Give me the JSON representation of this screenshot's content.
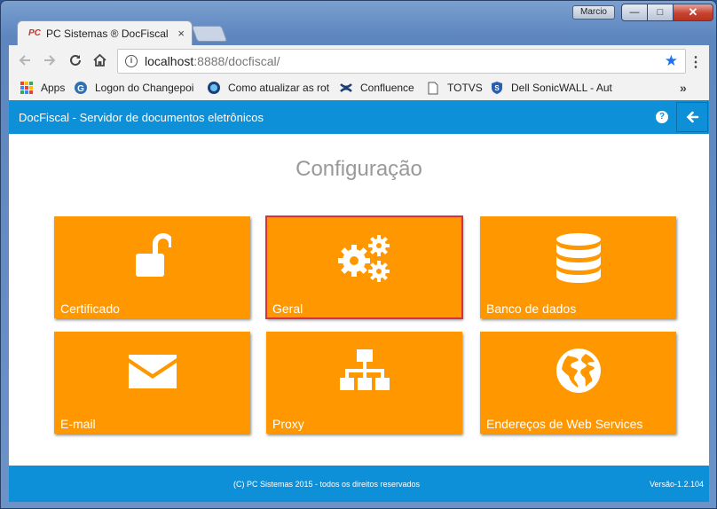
{
  "window": {
    "user_label": "Marcio",
    "minimize_glyph": "—",
    "maximize_glyph": "□",
    "close_glyph": "✕"
  },
  "tab": {
    "favicon_text": "PC",
    "title": "PC Sistemas ® DocFiscal",
    "close_glyph": "×"
  },
  "address_bar": {
    "host": "localhost",
    "rest": ":8888/docfiscal/"
  },
  "bookmarks": [
    {
      "label": "Apps",
      "icon": "apps-grid-icon"
    },
    {
      "label": "Logon do Changepoi",
      "icon": "changepoint-icon"
    },
    {
      "label": "Como atualizar as rot",
      "icon": "globe-icon"
    },
    {
      "label": "Confluence",
      "icon": "confluence-icon"
    },
    {
      "label": "TOTVS",
      "icon": "page-icon"
    },
    {
      "label": "Dell SonicWALL - Aut",
      "icon": "shield-icon"
    }
  ],
  "bookmarks_more": "»",
  "app": {
    "header_title": "DocFiscal - Servidor de documentos eletrônicos",
    "help_glyph": "?",
    "page_title": "Configuração",
    "tiles": [
      {
        "label": "Certificado",
        "icon": "unlock-icon",
        "selected": false
      },
      {
        "label": "Geral",
        "icon": "gears-icon",
        "selected": true
      },
      {
        "label": "Banco de dados",
        "icon": "database-icon",
        "selected": false
      },
      {
        "label": "E-mail",
        "icon": "envelope-icon",
        "selected": false
      },
      {
        "label": "Proxy",
        "icon": "sitemap-icon",
        "selected": false
      },
      {
        "label": "Endereços de Web Services",
        "icon": "globe-icon",
        "selected": false
      }
    ],
    "footer_copy": "(C) PC Sistemas 2015 - todos os direitos reservados",
    "footer_version": "Versão-1.2.104"
  },
  "colors": {
    "header": "#0e90d9",
    "tile": "#ff9800",
    "selected_outline": "#e03030",
    "title_gray": "#999999"
  }
}
